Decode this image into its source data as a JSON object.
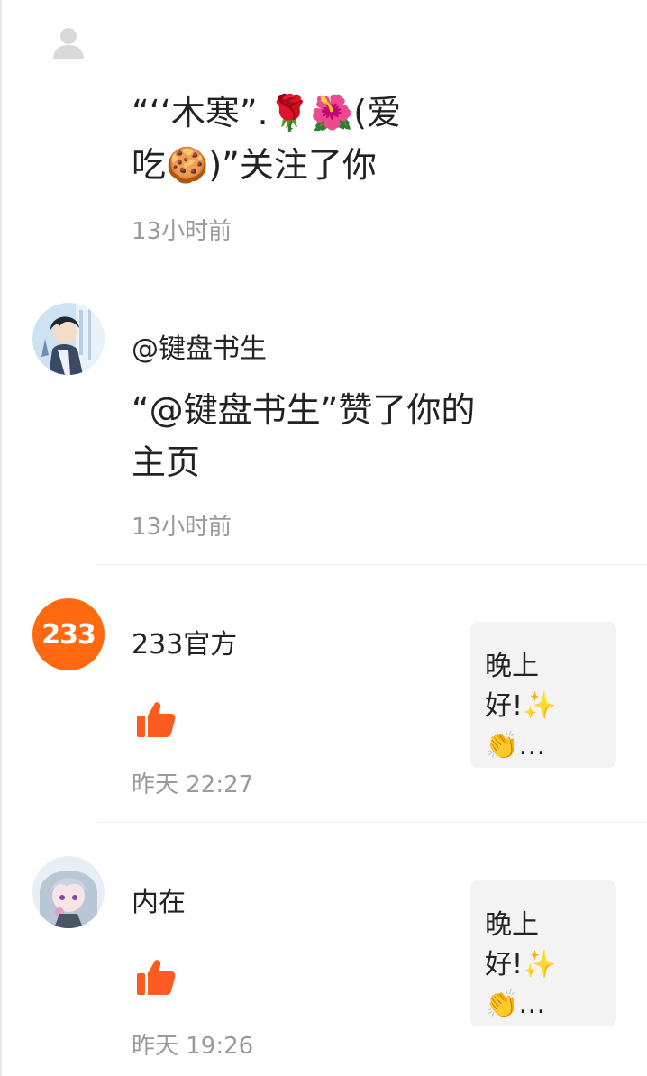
{
  "notifications": [
    {
      "avatar": "default-user-icon",
      "message_line1": "“‘‘木寒”.🌹🌺(爱",
      "message_line2": "吃🍪)”关注了你",
      "time": "13小时前"
    },
    {
      "avatar": "anime-boy-avatar",
      "name": "@键盘书生",
      "message_line1": "“@键盘书生”赞了你的",
      "message_line2": "主页",
      "time": "13小时前"
    },
    {
      "avatar": "233-logo",
      "avatar_text": "233",
      "name": "233官方",
      "action_icon": "thumbs-up-icon",
      "time": "昨天 22:27",
      "preview_line1": "晚上",
      "preview_line2": "好!✨",
      "preview_line3": "👏…"
    },
    {
      "avatar": "anime-girl-avatar",
      "name": "内在",
      "action_icon": "thumbs-up-icon",
      "time": "昨天 19:26",
      "preview_line1": "晚上",
      "preview_line2": "好!✨",
      "preview_line3": "👏…"
    }
  ],
  "colors": {
    "accent": "#ff5a1f",
    "logo_bg": "#ff6a10",
    "time_text": "#9a9a9a",
    "preview_bg": "#f3f3f3",
    "divider": "#ececec"
  }
}
